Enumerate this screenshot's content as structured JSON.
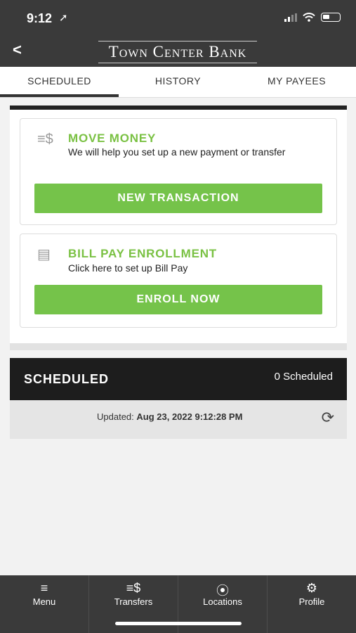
{
  "status": {
    "time": "9:12",
    "location_glyph": "➚"
  },
  "header": {
    "back_glyph": "<",
    "brand": "Town Center Bank"
  },
  "tabs": [
    {
      "label": "SCHEDULED",
      "active": true
    },
    {
      "label": "HISTORY",
      "active": false
    },
    {
      "label": "MY PAYEES",
      "active": false
    }
  ],
  "move_money": {
    "icon": "transfer-icon",
    "icon_glyph": "≡$",
    "title": "MOVE MONEY",
    "desc": "We will help you set up a new payment or transfer",
    "button": "NEW TRANSACTION"
  },
  "bill_pay": {
    "icon": "bill-icon",
    "icon_glyph": "▤",
    "title": "BILL PAY ENROLLMENT",
    "desc": "Click here to set up Bill Pay",
    "button": "ENROLL NOW"
  },
  "scheduled": {
    "title": "SCHEDULED",
    "count": "0 Scheduled",
    "updated_label": "Updated:",
    "updated_value": "Aug 23, 2022 9:12:28 PM",
    "refresh_glyph": "⟳"
  },
  "nav": [
    {
      "label": "Menu",
      "icon": "hamburger-icon",
      "glyph": "≡"
    },
    {
      "label": "Transfers",
      "icon": "transfer-icon",
      "glyph": "≡$"
    },
    {
      "label": "Locations",
      "icon": "location-pin-icon",
      "glyph": "⦿"
    },
    {
      "label": "Profile",
      "icon": "gear-icon",
      "glyph": "⚙"
    }
  ],
  "colors": {
    "accent_green": "#75c34a",
    "title_green": "#7ac143",
    "dark": "#1d1d1d",
    "header_bg": "#3a3a3a"
  }
}
